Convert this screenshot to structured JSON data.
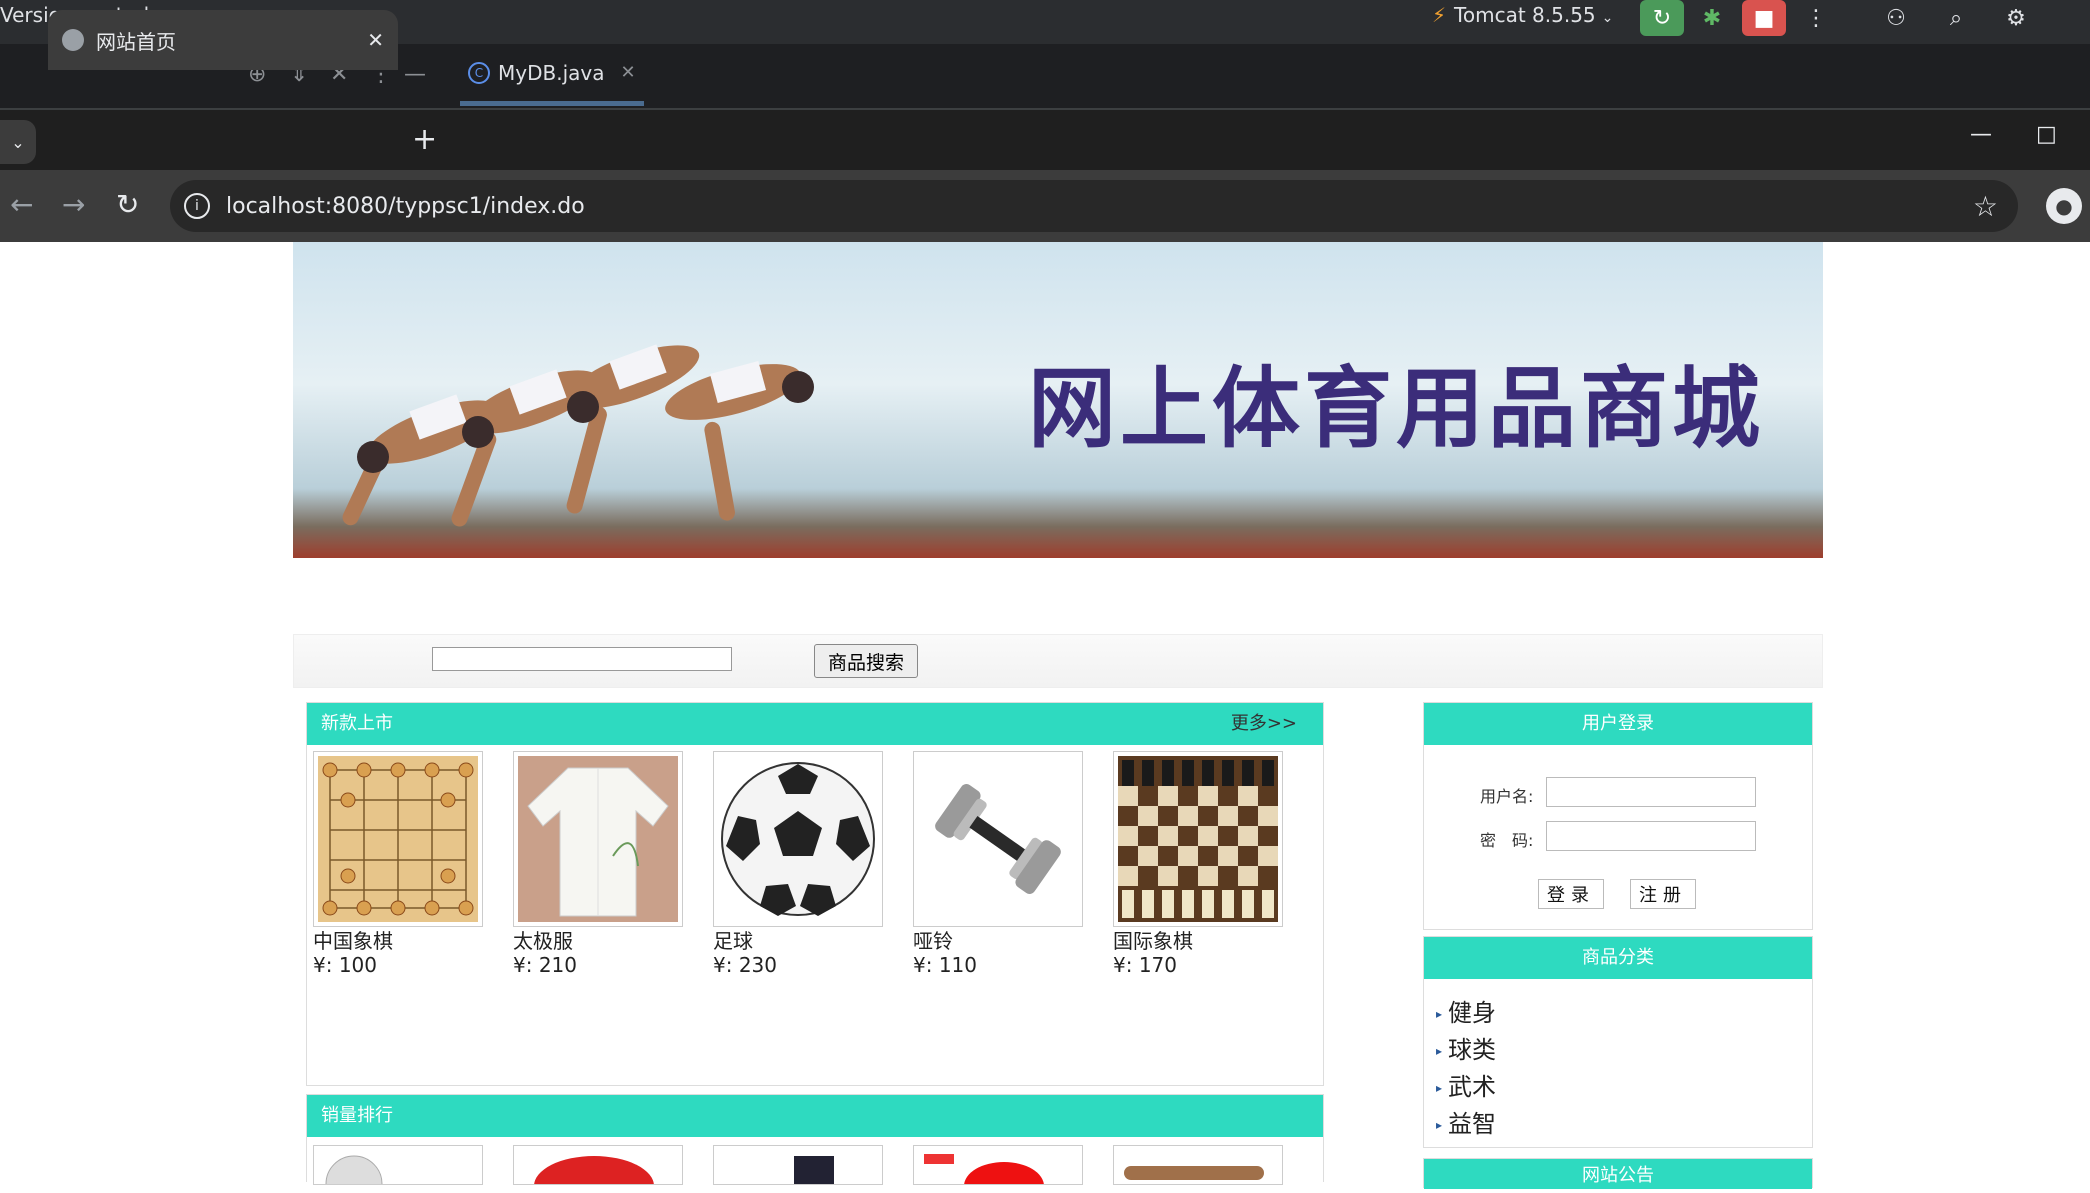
{
  "ide": {
    "vcs_label": "Version control",
    "run_config": "Tomcat 8.5.55",
    "tab": {
      "label": "MyDB.java"
    }
  },
  "browser": {
    "tab_title": "网站首页",
    "url": "localhost:8080/typpsc1/index.do"
  },
  "banner": {
    "title": "网上体育用品商城"
  },
  "search": {
    "input_value": "",
    "button": "商品搜索"
  },
  "new_arrivals": {
    "title": "新款上市",
    "more": "更多>>",
    "products": [
      {
        "name": "中国象棋",
        "price": "¥: 100",
        "icon": "chinese-chess-image"
      },
      {
        "name": "太极服",
        "price": "¥: 210",
        "icon": "taichi-suit-image"
      },
      {
        "name": "足球",
        "price": "¥: 230",
        "icon": "soccer-ball-image"
      },
      {
        "name": "哑铃",
        "price": "¥: 110",
        "icon": "dumbbell-image"
      },
      {
        "name": "国际象棋",
        "price": "¥: 170",
        "icon": "chess-image"
      }
    ]
  },
  "best_sellers": {
    "title": "销量排行"
  },
  "login": {
    "title": "用户登录",
    "username_label": "用户名:",
    "password_label": "密　码:",
    "login_button": "登录",
    "register_button": "注册"
  },
  "categories": {
    "title": "商品分类",
    "items": [
      "健身",
      "球类",
      "武术",
      "益智"
    ]
  },
  "announcements": {
    "title": "网站公告"
  }
}
